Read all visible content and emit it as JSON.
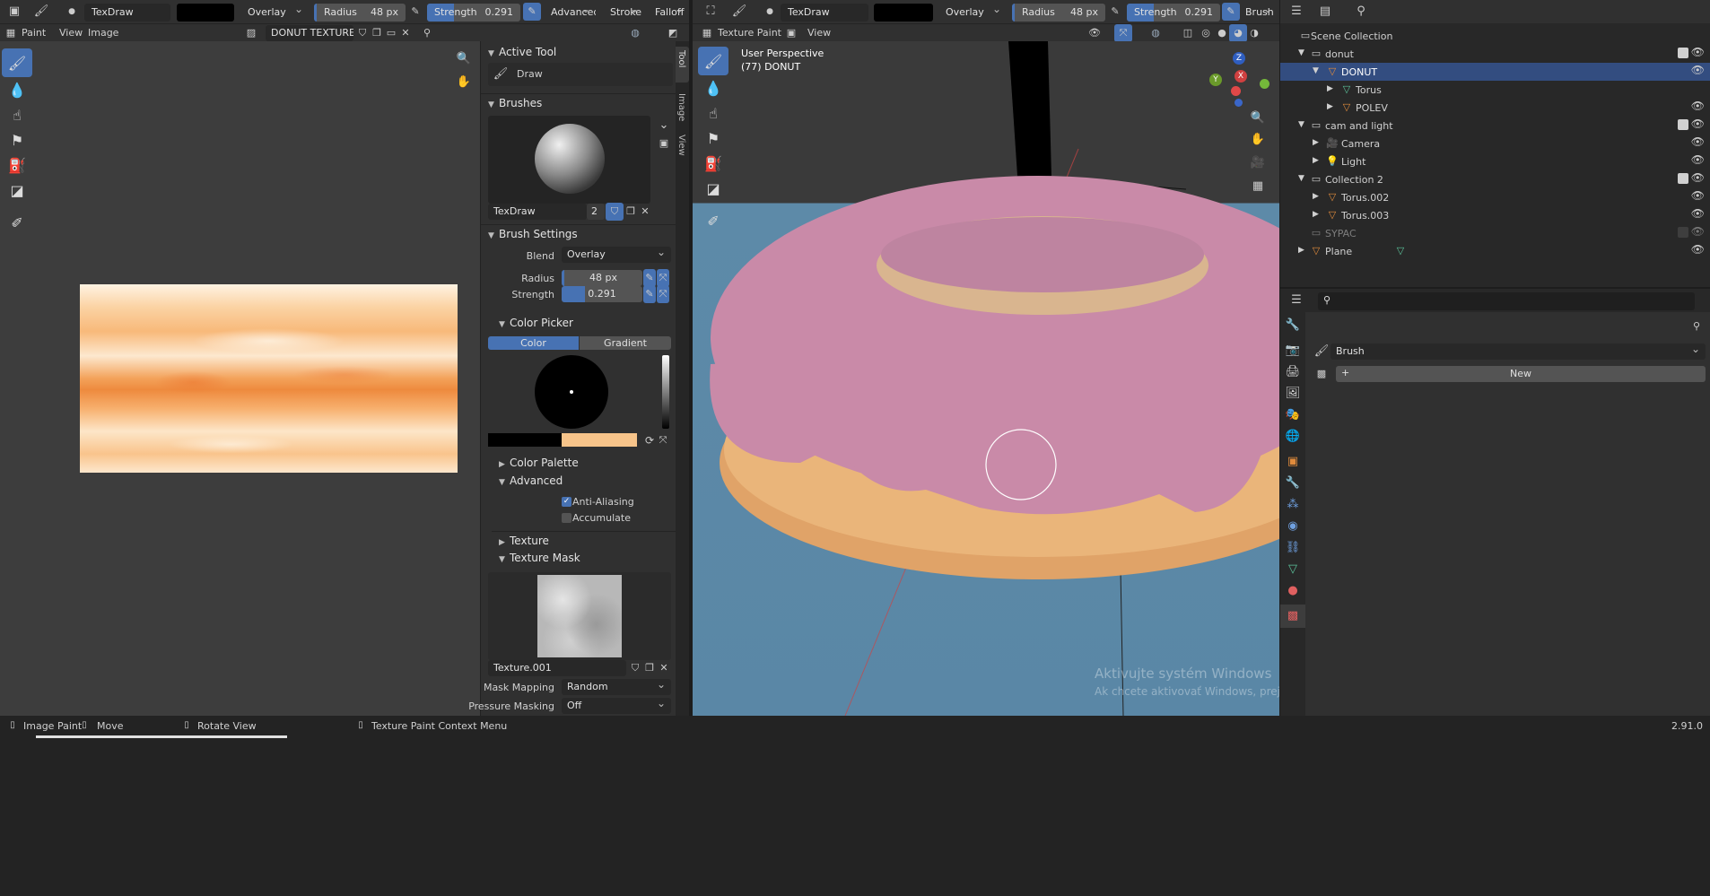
{
  "image_editor": {
    "brush_name": "TexDraw",
    "blend": "Overlay",
    "radius_label": "Radius",
    "radius_value": "48 px",
    "strength_label": "Strength",
    "strength_value": "0.291",
    "strength_fraction": 0.291,
    "advanced_label": "Advanced",
    "stroke_label": "Stroke",
    "falloff_label": "Falloff",
    "mode": "Paint",
    "menu_view": "View",
    "menu_image": "Image",
    "image_name": "DONUT TEXTURE"
  },
  "sidebar_tabs": [
    "Tool",
    "Image",
    "View"
  ],
  "tool_panel": {
    "active_tool_header": "Active Tool",
    "active_tool_name": "Draw",
    "brushes_header": "Brushes",
    "brush_name": "TexDraw",
    "brush_users": "2",
    "brush_settings_header": "Brush Settings",
    "blend_label": "Blend",
    "blend_value": "Overlay",
    "radius_label": "Radius",
    "radius_value": "48 px",
    "strength_label": "Strength",
    "strength_value": "0.291",
    "color_picker_header": "Color Picker",
    "tab_color": "Color",
    "tab_gradient": "Gradient",
    "primary_color": "#000000",
    "secondary_color": "#f7c48a",
    "color_palette_header": "Color Palette",
    "advanced_header": "Advanced",
    "anti_aliasing_label": "Anti-Aliasing",
    "anti_aliasing_checked": true,
    "accumulate_label": "Accumulate",
    "accumulate_checked": false,
    "texture_header": "Texture",
    "texture_mask_header": "Texture Mask",
    "mask_texture_name": "Texture.001",
    "mask_mapping_label": "Mask Mapping",
    "mask_mapping_value": "Random",
    "pressure_masking_label": "Pressure Masking",
    "pressure_masking_value": "Off"
  },
  "viewport": {
    "brush_name": "TexDraw",
    "blend": "Overlay",
    "radius_label": "Radius",
    "radius_value": "48 px",
    "strength_label": "Strength",
    "strength_value": "0.291",
    "brush_menu": "Brush",
    "mode": "Texture Paint",
    "menu_view": "View",
    "perspective": "User Perspective",
    "object_info": "(77) DONUT",
    "gizmo_z": "Z",
    "gizmo_x": "X",
    "gizmo_y": "Y",
    "watermark_title": "Aktivujte systém Windows",
    "watermark_sub": "Ak chcete aktivovať Windows, prejdite na nastavenia."
  },
  "outliner": {
    "root": "Scene Collection",
    "rows": [
      {
        "label": "donut"
      },
      {
        "label": "DONUT"
      },
      {
        "label": "Torus"
      },
      {
        "label": "POLEV"
      },
      {
        "label": "cam and light"
      },
      {
        "label": "Camera"
      },
      {
        "label": "Light"
      },
      {
        "label": "Collection 2"
      },
      {
        "label": "Torus.002"
      },
      {
        "label": "Torus.003"
      },
      {
        "label": "SYPAC"
      },
      {
        "label": "Plane"
      }
    ]
  },
  "properties": {
    "brush_dropdown": "Brush",
    "new_button": "New"
  },
  "status_bar": {
    "item1": "Image Paint",
    "item2": "Move",
    "item3": "Rotate View",
    "item4": "Texture Paint Context Menu",
    "version": "2.91.0"
  },
  "colors": {
    "accent": "#4772b3",
    "viewport_bg": "#5d8aa8",
    "donut_icing": "#c98aa8"
  }
}
